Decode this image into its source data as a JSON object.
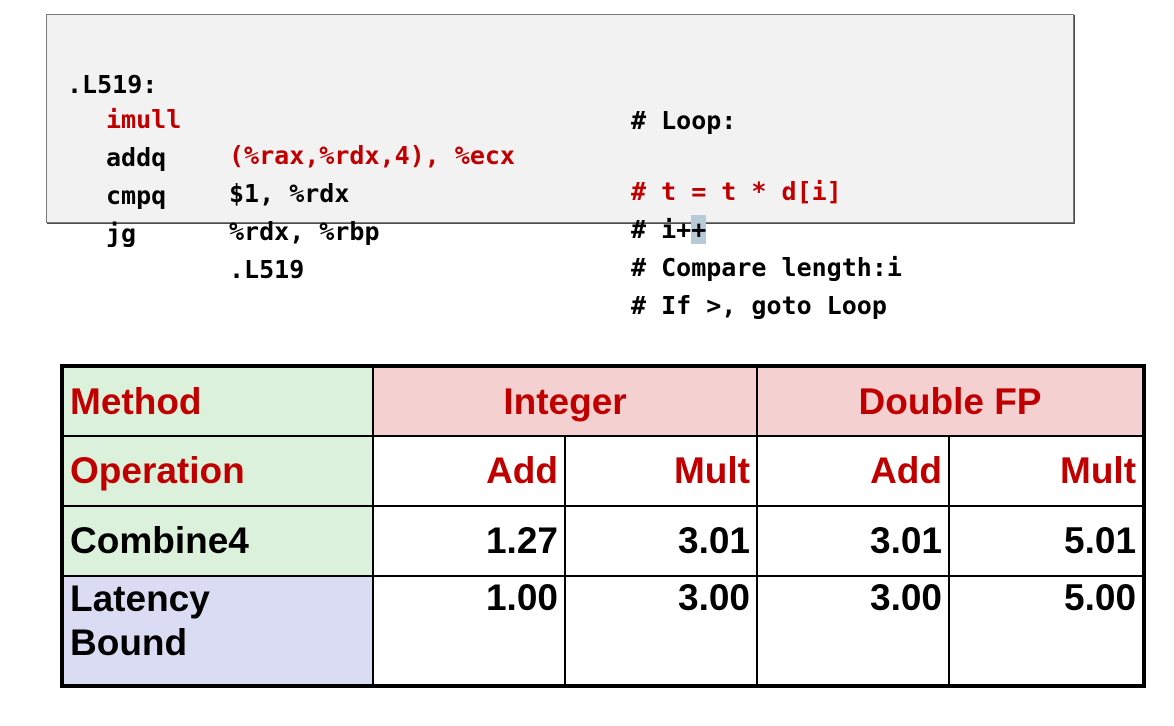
{
  "code": {
    "lines": [
      {
        "label": ".L519:",
        "instr": "",
        "args": "",
        "comment": "# Loop:",
        "highlight": false
      },
      {
        "label": "",
        "instr": "imull",
        "args": "(%rax,%rdx,4), %ecx",
        "comment": "# t = t * d[i]",
        "highlight": true
      },
      {
        "label": "",
        "instr": "addq",
        "args": "$1, %rdx",
        "comment": "# i+",
        "comment_tail": "+",
        "highlight": false
      },
      {
        "label": "",
        "instr": "cmpq",
        "args": "%rdx, %rbp",
        "comment": "# Compare length:i",
        "highlight": false
      },
      {
        "label": "",
        "instr": "jg",
        "args": ".L519",
        "comment": "# If >, goto Loop",
        "highlight": false
      }
    ],
    "colors": {
      "highlight_text": "#c00000",
      "box_bg": "#f2f2f2"
    }
  },
  "table": {
    "method_label": "Method",
    "operation_label": "Operation",
    "groups": [
      "Integer",
      "Double FP"
    ],
    "operations": [
      "Add",
      "Mult",
      "Add",
      "Mult"
    ],
    "rows": [
      {
        "label": "Combine4",
        "values": [
          "1.27",
          "3.01",
          "3.01",
          "5.01"
        ]
      },
      {
        "label_line1": "Latency",
        "label_line2": "Bound",
        "values": [
          "1.00",
          "3.00",
          "3.00",
          "5.00"
        ]
      }
    ],
    "colors": {
      "header_text": "#c00000",
      "label_green": "#dbf1db",
      "label_blue": "#d9dcf2",
      "header_pink": "#f4d0d0"
    }
  }
}
